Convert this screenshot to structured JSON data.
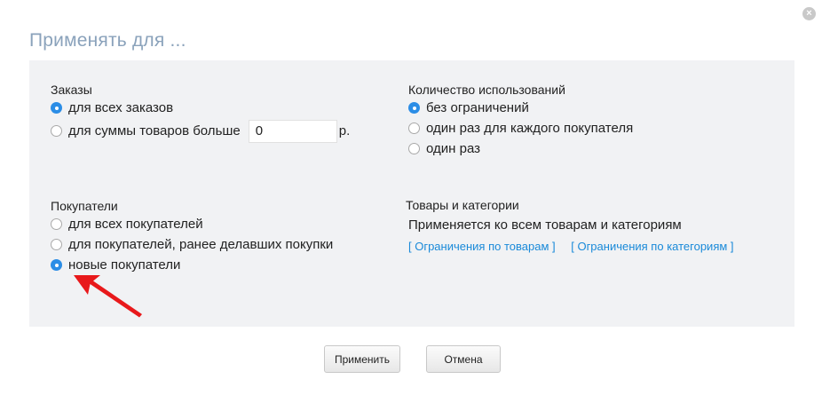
{
  "dialog": {
    "title": "Применять для ...",
    "close_glyph": "×"
  },
  "orders": {
    "label": "Заказы",
    "options": [
      {
        "label": "для всех заказов",
        "checked": true
      },
      {
        "label": "для суммы товаров больше",
        "checked": false
      }
    ],
    "amount_value": "0",
    "amount_unit": "р."
  },
  "usage": {
    "label": "Количество использований",
    "options": [
      {
        "label": "без ограничений",
        "checked": true
      },
      {
        "label": "один раз для каждого покупателя",
        "checked": false
      },
      {
        "label": "один раз",
        "checked": false
      }
    ]
  },
  "customers": {
    "label": "Покупатели",
    "options": [
      {
        "label": "для всех покупателей",
        "checked": false
      },
      {
        "label": "для покупателей, ранее делавших покупки",
        "checked": false
      },
      {
        "label": "новые покупатели",
        "checked": true
      }
    ]
  },
  "products": {
    "label": "Товары и категории",
    "note": "Применяется ко всем товарам и категориям",
    "link_products": "[ Ограничения по товарам ]",
    "link_categories": "[ Ограничения по категориям ]"
  },
  "buttons": {
    "apply": "Применить",
    "cancel": "Отмена"
  },
  "colors": {
    "title": "#8aa2bb",
    "panel": "#f1f2f4",
    "radio_checked": "#2b8de6",
    "link": "#1a8ad9",
    "annotation_arrow": "#e8191b"
  },
  "icons": [
    "close-icon",
    "annotation-arrow-icon"
  ]
}
